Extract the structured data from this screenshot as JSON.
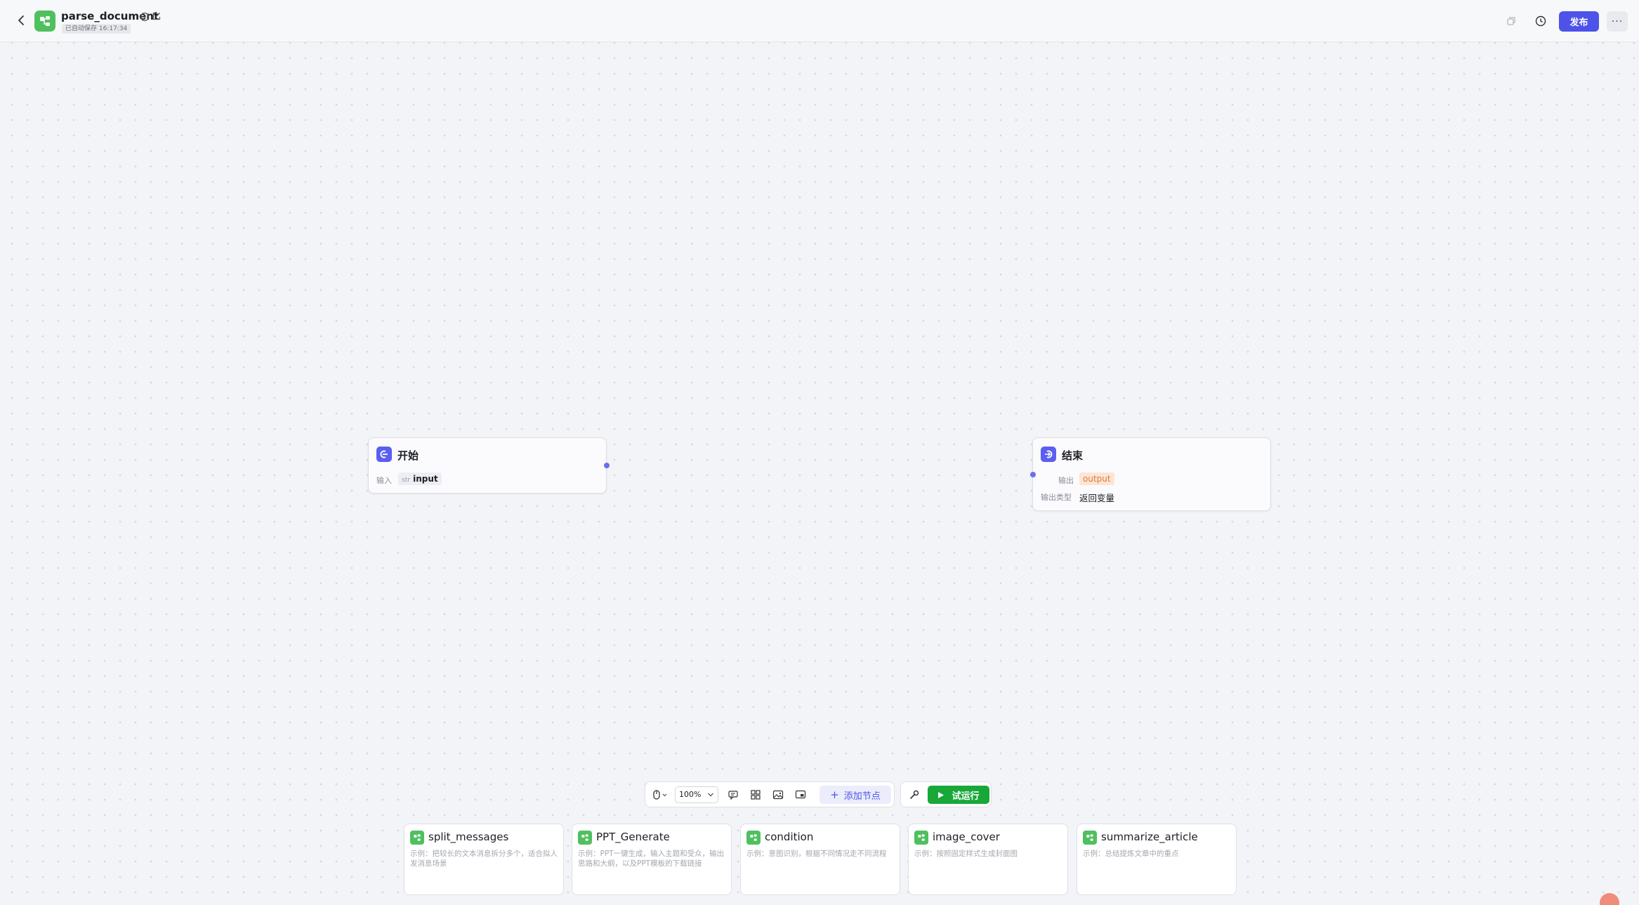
{
  "header": {
    "title": "parse_document",
    "autosave": "已自动保存 16:17:34",
    "publish_label": "发布",
    "more_label": "···"
  },
  "canvas": {
    "start_node": {
      "title": "开始",
      "input_label": "输入",
      "input_type": "str",
      "input_var": "input"
    },
    "end_node": {
      "title": "结束",
      "output_label": "输出",
      "output_var": "output",
      "output_type_label": "输出类型",
      "output_type_value": "返回变量"
    }
  },
  "toolbar": {
    "zoom": "100%",
    "add_node_label": "添加节点",
    "run_label": "试运行"
  },
  "templates": [
    {
      "name": "split_messages",
      "desc": "示例：把较长的文本消息拆分多个，适合拟人发消息场景"
    },
    {
      "name": "PPT_Generate",
      "desc": "示例：PPT一键生成，输入主题和受众，输出思路和大纲，以及PPT模板的下载链接"
    },
    {
      "name": "condition",
      "desc": "示例：意图识别，根据不同情况走不同流程"
    },
    {
      "name": "image_cover",
      "desc": "示例：按照固定样式生成封面图"
    },
    {
      "name": "summarize_article",
      "desc": "示例：总结提炼文章中的重点"
    }
  ],
  "colors": {
    "brand": "#4d53e8",
    "run": "#18a83a",
    "app_icon": "#4fc05e"
  }
}
